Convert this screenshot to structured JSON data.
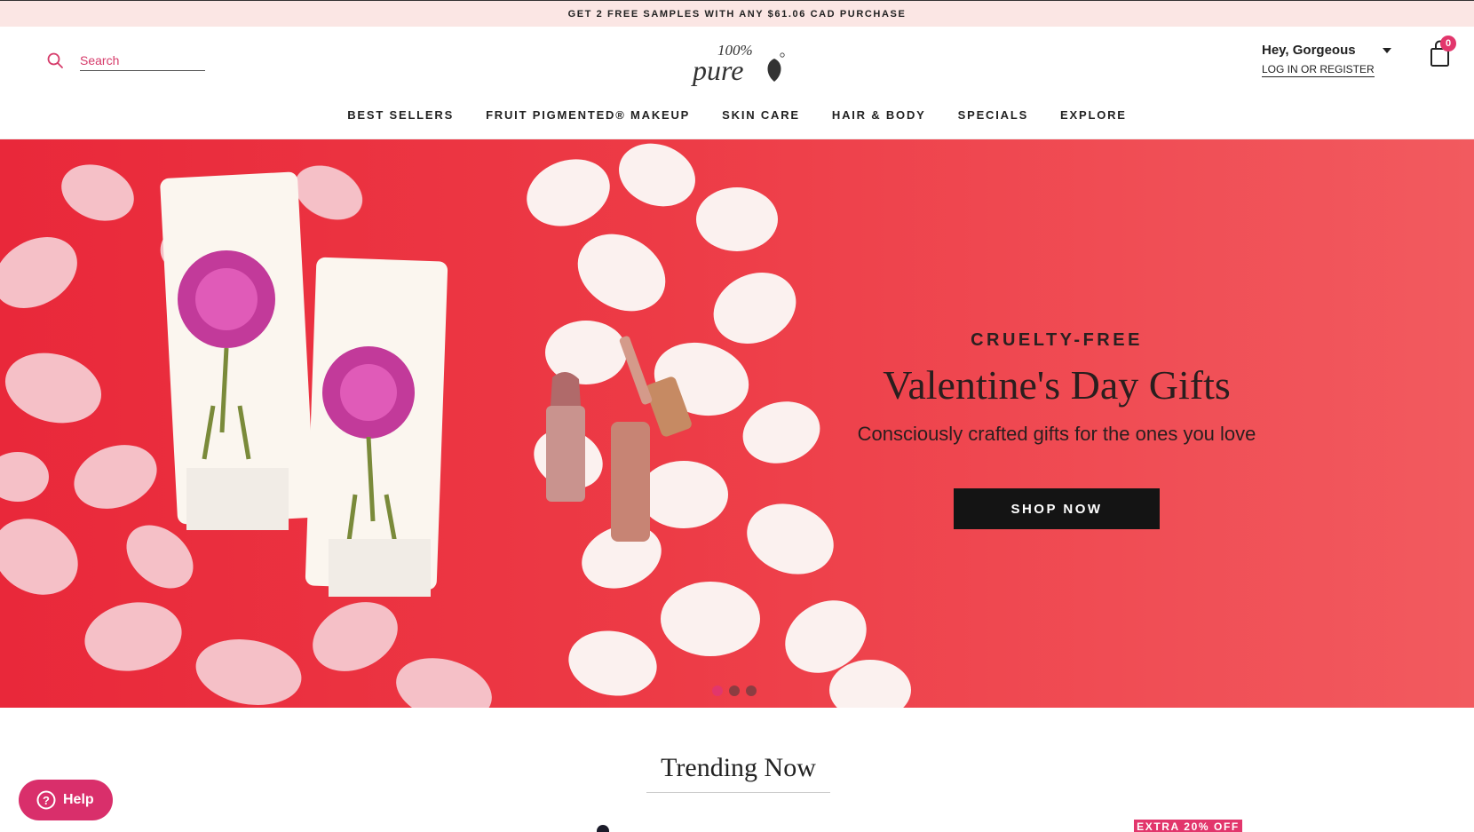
{
  "promo": {
    "text": "GET 2 FREE SAMPLES WITH ANY $61.06 CAD PURCHASE"
  },
  "header": {
    "search_placeholder": "Search",
    "logo_text": "100% pure",
    "greeting": "Hey, Gorgeous",
    "login_label": "LOG IN OR REGISTER",
    "cart_count": "0"
  },
  "nav": {
    "items": [
      {
        "label": "BEST SELLERS"
      },
      {
        "label": "FRUIT PIGMENTED® MAKEUP"
      },
      {
        "label": "SKIN CARE"
      },
      {
        "label": "HAIR & BODY"
      },
      {
        "label": "SPECIALS"
      },
      {
        "label": "EXPLORE"
      }
    ]
  },
  "hero": {
    "eyebrow": "CRUELTY-FREE",
    "headline": "Valentine's Day Gifts",
    "subline": "Consciously crafted gifts for the ones you love",
    "cta_label": "SHOP NOW",
    "slide_count": 3,
    "active_slide": 1
  },
  "trending": {
    "title": "Trending Now",
    "badge": "EXTRA 20% OFF"
  },
  "help": {
    "label": "Help"
  },
  "colors": {
    "accent": "#e2366c",
    "promo_bg": "#fbe6e4",
    "hero_red": "#ed3b46",
    "button_dark": "#141414"
  }
}
